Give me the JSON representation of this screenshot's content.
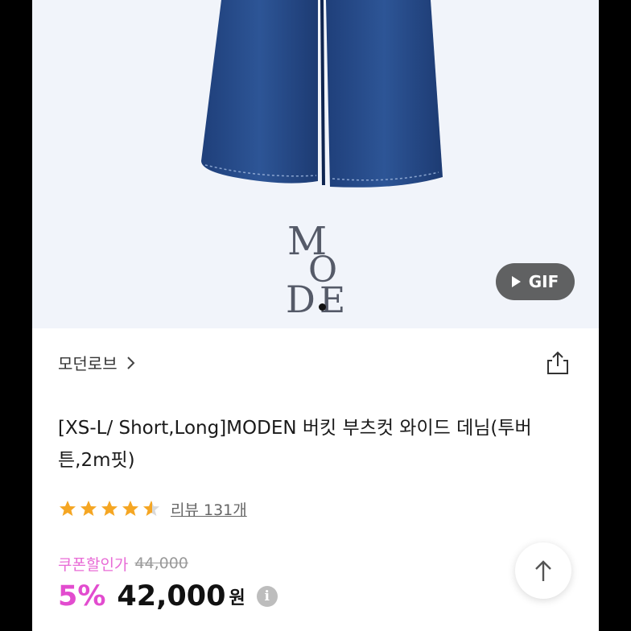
{
  "hero": {
    "gif_label": "GIF",
    "logo_text": "MODE",
    "play_icon": "play-icon"
  },
  "brand": {
    "name": "모던로브",
    "chevron_icon": "chevron-right-icon",
    "share_icon": "share-icon"
  },
  "product": {
    "title": "[XS-L/ Short,Long]MODEN 버킷 부츠컷 와이드 데님(투버튼,2m핏)",
    "rating": 4.5,
    "rating_max": 5,
    "review_text": "리뷰 131개"
  },
  "pricing": {
    "coupon_label": "쿠폰할인가",
    "original_price": "44,000",
    "discount": "5%",
    "price": "42,000",
    "currency": "원",
    "info_icon": "info-icon"
  },
  "controls": {
    "scroll_top_icon": "arrow-up-icon"
  },
  "colors": {
    "accent_pink": "#e24ccf",
    "coupon_pink": "#e86bd6",
    "star": "#f5a623"
  }
}
